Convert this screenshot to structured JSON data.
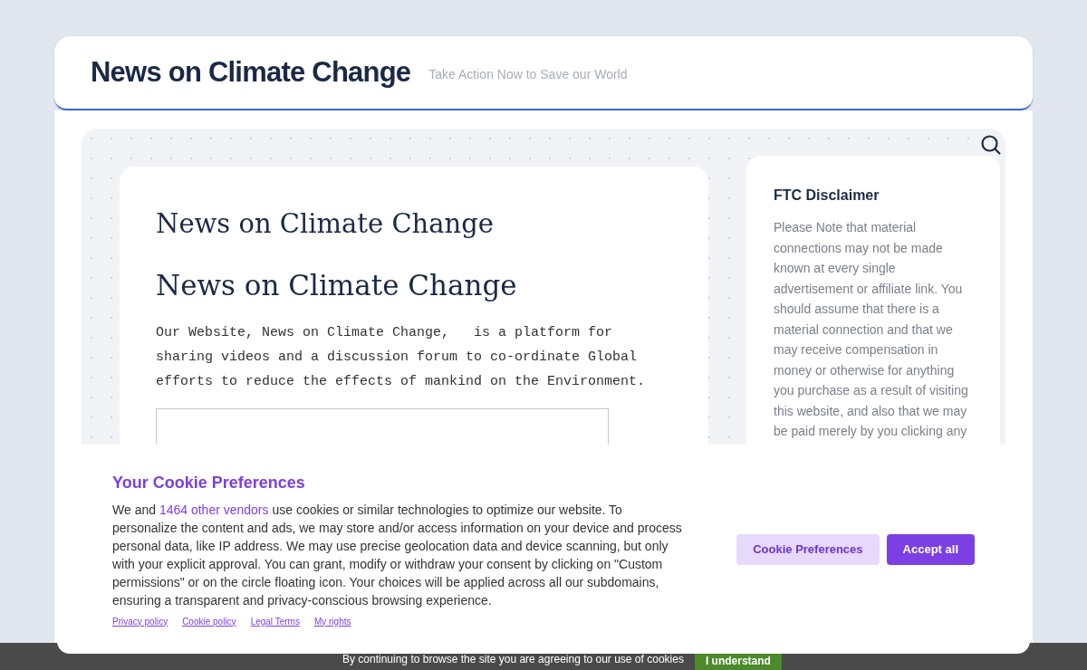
{
  "header": {
    "title": "News on Climate Change",
    "tagline": "Take Action Now to Save our World"
  },
  "article": {
    "heading_1": "News on Climate Change",
    "heading_2": "News on Climate Change",
    "paragraph": "Our Website, News on Climate Change,   is a platform for sharing videos and a discussion forum to co-ordinate Global efforts to reduce the effects of mankind on the Environment."
  },
  "sidebar": {
    "title": "FTC Disclaimer",
    "text": "Please Note that material connections may not be made known at every single advertisement or affiliate link. You should assume that there is a material connection and that we may receive compensation in money or otherwise for anything you purchase as a result of visiting this website, and also that we may be paid merely by you clicking any"
  },
  "cookie_dialog": {
    "title": "Your Cookie Preferences",
    "text_before": "We and ",
    "vendors_link": "1464 other vendors",
    "text_after": " use cookies or similar technologies to optimize our website. To personalize the content and ads, we may store and/or access information on your device and process personal data, like IP address. We may use precise geolocation data and device scanning, but only with your explicit approval. You can grant, modify or withdraw your consent by clicking on \"Custom permissions\" or on the circle floating icon. Your choices will be applied across all our subdomains, ensuring a transparent and privacy-conscious browsing experience.",
    "links": [
      "Privacy policy",
      "Cookie policy",
      "Legal Terms",
      "My rights"
    ],
    "buttons": [
      {
        "label": "Cookie Preferences",
        "kind": "secondary"
      },
      {
        "label": "Accept all",
        "kind": "primary"
      }
    ]
  },
  "cookie_bar": {
    "text": "By continuing to browse the site you are agreeing to our use of cookies",
    "button": "I understand"
  }
}
